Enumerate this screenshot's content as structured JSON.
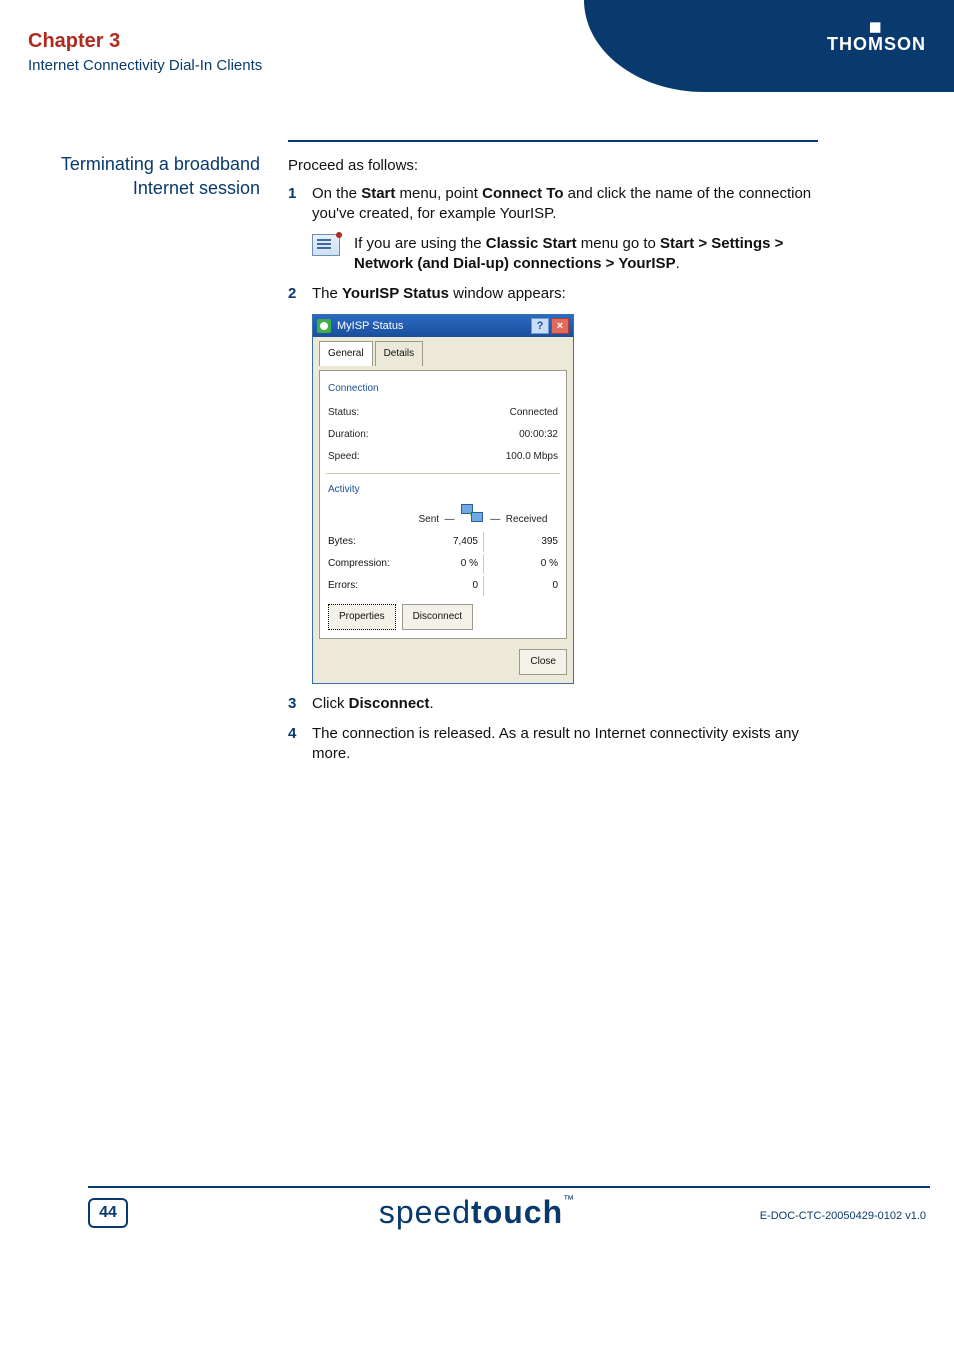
{
  "header": {
    "chapter": "Chapter 3",
    "subtitle": "Internet Connectivity Dial-In Clients",
    "brand": "THOMSON"
  },
  "side_title": "Terminating a broadband Internet session",
  "intro": "Proceed as follows:",
  "steps": {
    "s1_pre": "On the ",
    "s1_b1": "Start",
    "s1_mid1": " menu, point ",
    "s1_b2": "Connect To",
    "s1_post": " and click the name of the connection you've created, for example YourISP.",
    "note_pre": "If you are using the ",
    "note_b1": "Classic Start",
    "note_mid": " menu go to ",
    "note_b2": "Start > Settings > Network (and Dial-up) connections > YourISP",
    "note_post": ".",
    "s2_pre": "The ",
    "s2_b": "YourISP Status",
    "s2_post": " window appears:",
    "s3_pre": "Click ",
    "s3_b": "Disconnect",
    "s3_post": ".",
    "s4": "The connection is released. As a result no Internet connectivity exists any more."
  },
  "nums": {
    "n1": "1",
    "n2": "2",
    "n3": "3",
    "n4": "4"
  },
  "dialog": {
    "title": "MyISP Status",
    "help": "?",
    "close": "×",
    "tab_general": "General",
    "tab_details": "Details",
    "group_connection": "Connection",
    "status_label": "Status:",
    "status_value": "Connected",
    "duration_label": "Duration:",
    "duration_value": "00:00:32",
    "speed_label": "Speed:",
    "speed_value": "100.0 Mbps",
    "group_activity": "Activity",
    "sent_label": "Sent",
    "received_label": "Received",
    "bytes_label": "Bytes:",
    "bytes_sent": "7,405",
    "bytes_recv": "395",
    "compression_label": "Compression:",
    "compression_sent": "0 %",
    "compression_recv": "0 %",
    "errors_label": "Errors:",
    "errors_sent": "0",
    "errors_recv": "0",
    "btn_properties": "Properties",
    "btn_disconnect": "Disconnect",
    "btn_close": "Close"
  },
  "footer": {
    "page": "44",
    "logo_light": "speed",
    "logo_bold": "touch",
    "tm": "™",
    "docid": "E-DOC-CTC-20050429-0102 v1.0"
  }
}
